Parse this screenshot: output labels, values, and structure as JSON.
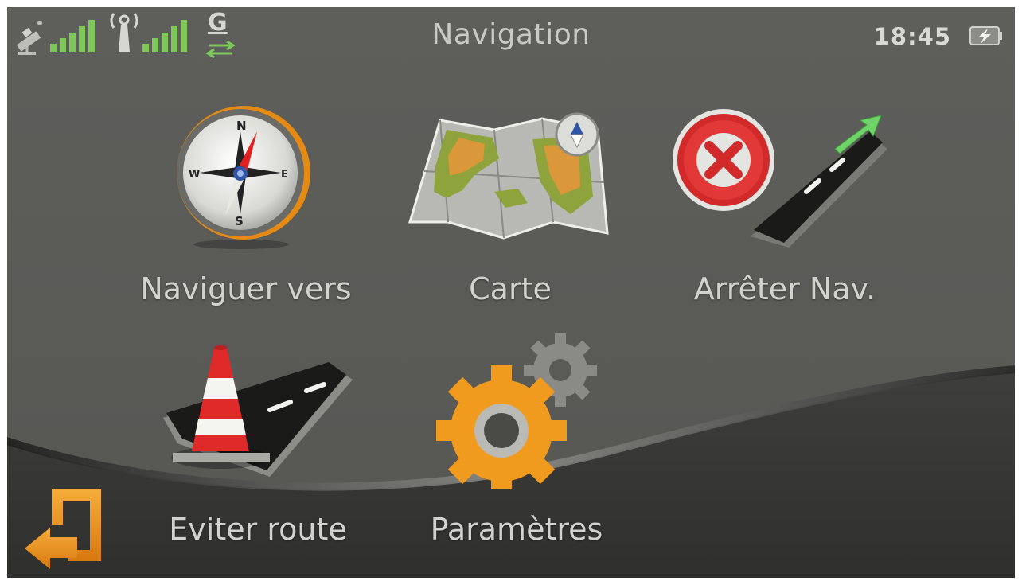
{
  "status_bar": {
    "title": "Navigation",
    "clock": "18:45",
    "network_letter": "G",
    "icons": [
      "satellite-icon",
      "gps-signal-icon",
      "antenna-icon",
      "cell-signal-icon",
      "data-transfer-icon",
      "battery-charging-icon"
    ]
  },
  "menu": {
    "items": [
      {
        "label": "Naviguer vers",
        "icon": "compass-icon"
      },
      {
        "label": "Carte",
        "icon": "map-icon"
      },
      {
        "label": "Arrêter Nav.",
        "icon": "stop-navigation-icon"
      },
      {
        "label": "Eviter route",
        "icon": "traffic-cone-road-icon"
      },
      {
        "label": "Paramètres",
        "icon": "gears-icon"
      }
    ]
  },
  "footer": {
    "back_icon": "back-arrow-icon"
  },
  "colors": {
    "background": "#5a5a57",
    "footer_band": "#353533",
    "signal_green": "#7ec85a",
    "accent_orange": "#f09a1e",
    "label_text": "#d2d2cf"
  }
}
